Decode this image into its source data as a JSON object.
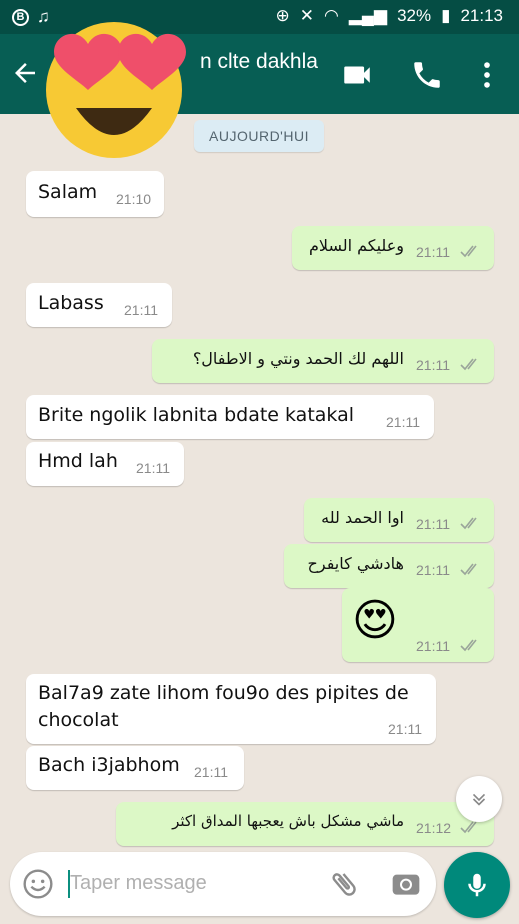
{
  "status_bar": {
    "battery": "32%",
    "time": "21:13"
  },
  "header": {
    "contact_name": "n clte dakhla"
  },
  "date_chip": "AUJOURD'HUI",
  "messages": [
    {
      "text": "Salam",
      "time": "21:10"
    },
    {
      "text": "وعليكم السلام",
      "time": "21:11"
    },
    {
      "text": "Labass",
      "time": "21:11"
    },
    {
      "text": "اللهم لك الحمد ونتي و الاطفال؟",
      "time": "21:11"
    },
    {
      "text": "Brite ngolik labnita bdate katakal",
      "time": "21:11"
    },
    {
      "text": "Hmd lah",
      "time": "21:11"
    },
    {
      "text": "اوا الحمد لله",
      "time": "21:11"
    },
    {
      "text": "هادشي كايفرح",
      "time": "21:11"
    },
    {
      "text": "😍",
      "time": "21:11"
    },
    {
      "text": "Bal7a9 zate lihom fou9o des pipites de",
      "text2": "chocolat",
      "time": "21:11"
    },
    {
      "text": "Bach i3jabhom",
      "time": "21:11"
    },
    {
      "text": "ماشي مشكل باش يعجبها المداق اكثر",
      "time": "21:12"
    }
  ],
  "composer": {
    "placeholder": "Taper message"
  },
  "colors": {
    "header": "#075e54",
    "statusbar": "#054d44",
    "outgoing": "#dcf8c6",
    "incoming": "#ffffff",
    "accent": "#00897b"
  },
  "icons": [
    "back-arrow-icon",
    "video-call-icon",
    "phone-icon",
    "more-options-icon",
    "emoji-icon",
    "attach-icon",
    "camera-icon",
    "mic-icon",
    "scroll-down-icon",
    "double-check-icon"
  ]
}
